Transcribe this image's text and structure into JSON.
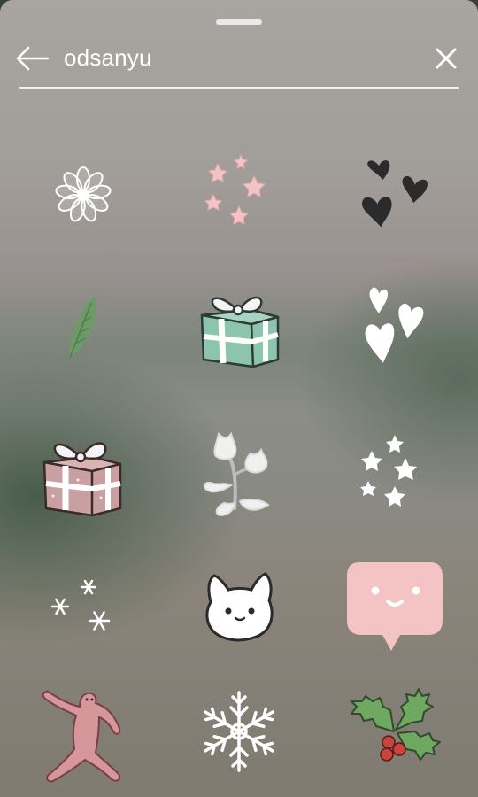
{
  "search": {
    "query": "odsanyu"
  },
  "icons": {
    "back": "arrow-left-icon",
    "clear": "close-icon"
  },
  "stickers": [
    "daisy-flower-sticker",
    "pink-stars-sticker",
    "black-hearts-sticker",
    "green-leaf-sticker",
    "teal-gift-box-sticker",
    "white-hearts-sticker",
    "pink-gift-box-sticker",
    "white-flowers-sticker",
    "white-stars-sticker",
    "snowflakes-sticker",
    "white-cat-face-sticker",
    "pink-speech-bubble-sticker",
    "dancing-pink-figure-sticker",
    "snowflake-sticker",
    "holly-sticker"
  ],
  "colors": {
    "accent_pink": "#f4c4c4",
    "gift_teal": "#8cc4ad",
    "gift_pink": "#c9a0a1",
    "leaf_green": "#6e9968",
    "text": "#ffffff"
  }
}
